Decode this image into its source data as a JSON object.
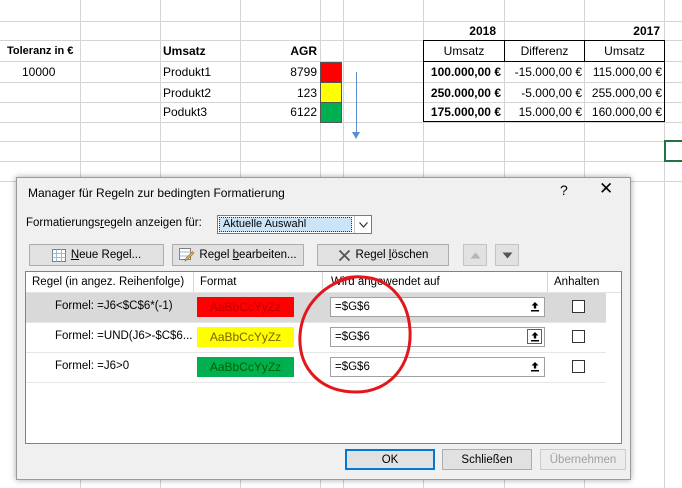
{
  "sheet": {
    "years": {
      "y2018": "2018",
      "y2017": "2017"
    },
    "table_headers": {
      "umsatz1": "Umsatz",
      "differenz": "Differenz",
      "umsatz2": "Umsatz"
    },
    "tolerance": {
      "label": "Toleranz in €",
      "value": "10000"
    },
    "products_header": {
      "umsatz": "Umsatz",
      "agr": "AGR"
    },
    "rows": [
      {
        "product": "Produkt1",
        "agr": "8799",
        "color": "#ff0000",
        "umsatz2018": "100.000,00 €",
        "differenz": "-15.000,00 €",
        "umsatz2017": "115.000,00 €"
      },
      {
        "product": "Produkt2",
        "agr": "123",
        "color": "#ffff00",
        "umsatz2018": "250.000,00 €",
        "differenz": "-5.000,00 €",
        "umsatz2017": "255.000,00 €"
      },
      {
        "product": "Podukt3",
        "agr": "6122",
        "color": "#00b050",
        "umsatz2018": "175.000,00 €",
        "differenz": "15.000,00 €",
        "umsatz2017": "160.000,00 €"
      }
    ]
  },
  "dialog": {
    "title": "Manager für Regeln zur bedingten Formatierung",
    "help": "?",
    "close": "✕",
    "show_rules_label": {
      "pre": "Formatierungs",
      "u": "r",
      "post": "egeln anzeigen für:"
    },
    "scope_value": "Aktuelle Auswahl",
    "toolbar": {
      "new_rule": {
        "u": "N",
        "rest": "eue Regel..."
      },
      "edit_rule": {
        "pre": "Regel ",
        "u": "b",
        "post": "earbeiten..."
      },
      "delete_rule": {
        "pre": "Regel ",
        "u": "l",
        "post": "öschen"
      }
    },
    "columns": {
      "rule": "Regel (in angez. Reihenfolge)",
      "format": "Format",
      "applies_to": "Wird angewendet auf",
      "stop": "Anhalten"
    },
    "rules": [
      {
        "formula": "Formel: =J6<$C$6*(-1)",
        "preview": "AaBbCcYyZz",
        "fmt_bg": "#ff0000",
        "fmt_fg": "#c00000",
        "applies": "=$G$6",
        "selected": true
      },
      {
        "formula": "Formel: =UND(J6>-$C$6...",
        "preview": "AaBbCcYyZz",
        "fmt_bg": "#ffff00",
        "fmt_fg": "#7f6000",
        "applies": "=$G$6",
        "selected": false
      },
      {
        "formula": "Formel: =J6>0",
        "preview": "AaBbCcYyZz",
        "fmt_bg": "#00b050",
        "fmt_fg": "#006100",
        "applies": "=$G$6",
        "selected": false
      }
    ],
    "buttons": {
      "ok": "OK",
      "close": "Schließen",
      "apply": "Übernehmen"
    }
  },
  "annotation_color": "#e3161c"
}
